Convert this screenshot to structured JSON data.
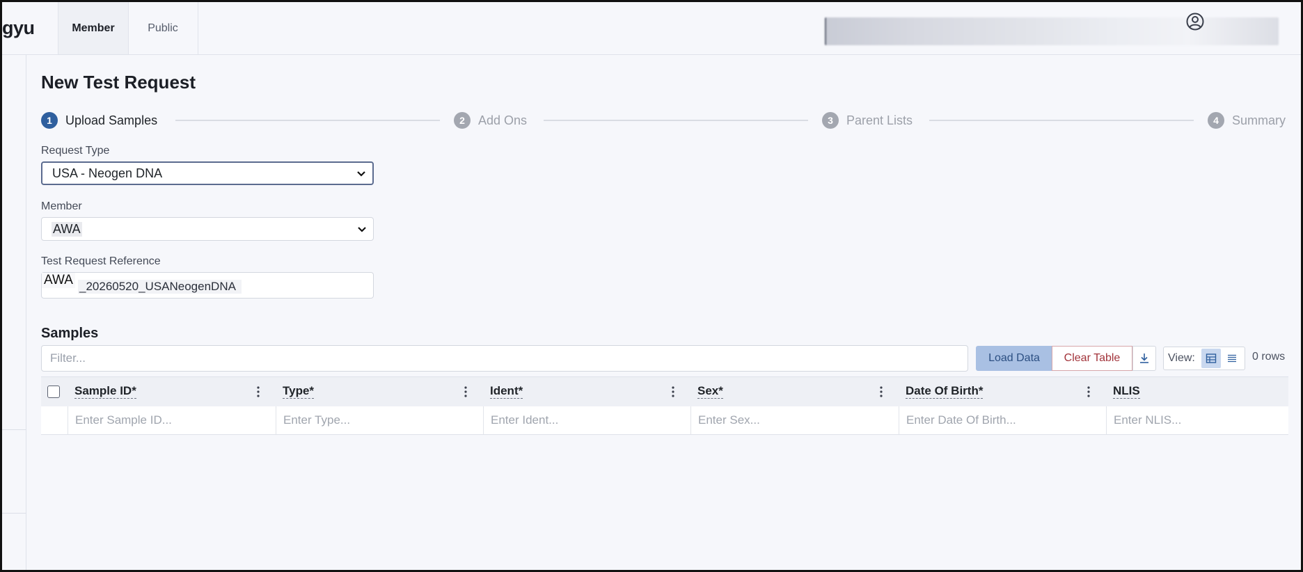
{
  "header": {
    "brand": "gyu",
    "tabs": [
      {
        "label": "Member",
        "active": true
      },
      {
        "label": "Public",
        "active": false
      }
    ]
  },
  "page": {
    "title": "New Test Request"
  },
  "stepper": {
    "steps": [
      {
        "num": "1",
        "label": "Upload Samples",
        "active": true
      },
      {
        "num": "2",
        "label": "Add Ons",
        "active": false
      },
      {
        "num": "3",
        "label": "Parent Lists",
        "active": false
      },
      {
        "num": "4",
        "label": "Summary",
        "active": false
      }
    ]
  },
  "form": {
    "request_type": {
      "label": "Request Type",
      "value": "USA - Neogen DNA"
    },
    "member": {
      "label": "Member",
      "value": "AWA"
    },
    "reference": {
      "label": "Test Request Reference",
      "prefix": "AWA",
      "suffix": "_20260520_USANeogenDNA"
    }
  },
  "samples": {
    "title": "Samples",
    "filter_placeholder": "Filter...",
    "load_label": "Load Data",
    "clear_label": "Clear Table",
    "view_label": "View:",
    "rows_count": "0 rows",
    "columns": [
      {
        "header": "Sample ID*",
        "placeholder": "Enter Sample ID..."
      },
      {
        "header": "Type*",
        "placeholder": "Enter Type..."
      },
      {
        "header": "Ident*",
        "placeholder": "Enter Ident..."
      },
      {
        "header": "Sex*",
        "placeholder": "Enter Sex..."
      },
      {
        "header": "Date Of Birth*",
        "placeholder": "Enter Date Of Birth..."
      },
      {
        "header": "NLIS",
        "placeholder": "Enter NLIS..."
      }
    ]
  },
  "colors": {
    "accent": "#2f5f9e",
    "load_button_bg": "#a9c0e3",
    "clear_button_text": "#a2333a",
    "step_inactive": "#a3a7b0"
  }
}
